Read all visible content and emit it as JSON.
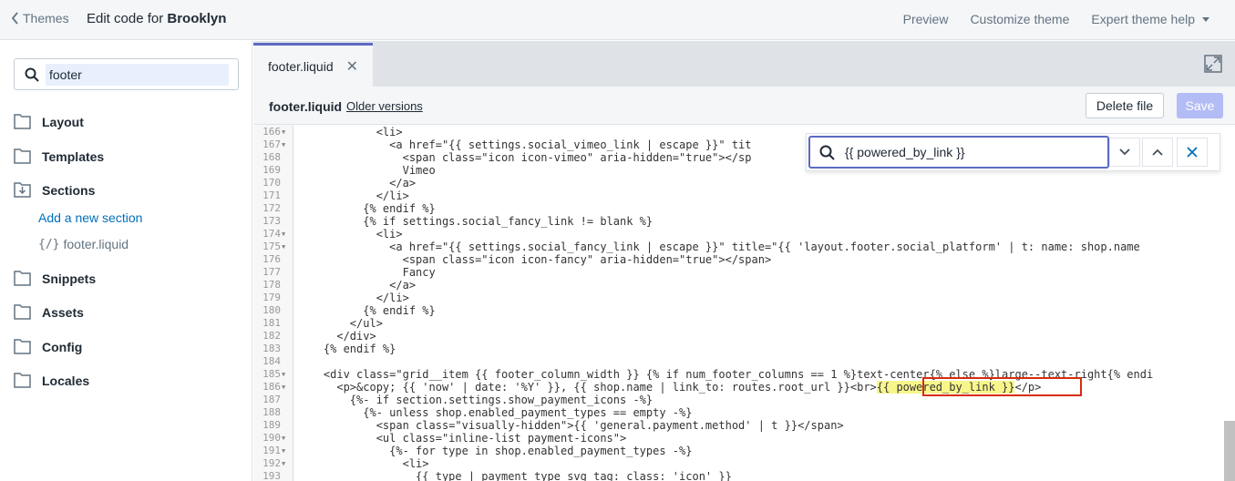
{
  "topbar": {
    "back_label": "Themes",
    "title_prefix": "Edit code for ",
    "title_theme": "Brooklyn",
    "preview": "Preview",
    "customize": "Customize theme",
    "help": "Expert theme help"
  },
  "sidebar": {
    "search_value": "footer",
    "folders": {
      "layout": "Layout",
      "templates": "Templates",
      "sections": "Sections",
      "snippets": "Snippets",
      "assets": "Assets",
      "config": "Config",
      "locales": "Locales"
    },
    "add_section": "Add a new section",
    "file_icon": "{/}",
    "file_name": "footer.liquid"
  },
  "editor": {
    "tab_label": "footer.liquid",
    "file_name": "footer.liquid",
    "older_versions": "Older versions",
    "delete_label": "Delete file",
    "save_label": "Save",
    "find_value": "{{ powered_by_link }}"
  },
  "code_lines": [
    {
      "n": "166",
      "fold": true
    },
    {
      "n": "167",
      "fold": true
    },
    {
      "n": "168",
      "fold": false
    },
    {
      "n": "169",
      "fold": false
    },
    {
      "n": "170",
      "fold": false
    },
    {
      "n": "171",
      "fold": false
    },
    {
      "n": "172",
      "fold": false
    },
    {
      "n": "173",
      "fold": false
    },
    {
      "n": "174",
      "fold": true
    },
    {
      "n": "175",
      "fold": true
    },
    {
      "n": "176",
      "fold": false
    },
    {
      "n": "177",
      "fold": false
    },
    {
      "n": "178",
      "fold": false
    },
    {
      "n": "179",
      "fold": false
    },
    {
      "n": "180",
      "fold": false
    },
    {
      "n": "181",
      "fold": false
    },
    {
      "n": "182",
      "fold": false
    },
    {
      "n": "183",
      "fold": false
    },
    {
      "n": "184",
      "fold": false
    },
    {
      "n": "185",
      "fold": true
    },
    {
      "n": "186",
      "fold": true
    },
    {
      "n": "187",
      "fold": false
    },
    {
      "n": "188",
      "fold": false
    },
    {
      "n": "189",
      "fold": false
    },
    {
      "n": "190",
      "fold": true
    },
    {
      "n": "191",
      "fold": true
    },
    {
      "n": "192",
      "fold": true
    },
    {
      "n": "193",
      "fold": false
    }
  ],
  "code_text": [
    "            <li>",
    "              <a href=\"{{ settings.social_vimeo_link | escape }}\" tit",
    "                <span class=\"icon icon-vimeo\" aria-hidden=\"true\"></sp",
    "                Vimeo",
    "              </a>",
    "            </li>",
    "          {% endif %}",
    "          {% if settings.social_fancy_link != blank %}",
    "            <li>",
    "              <a href=\"{{ settings.social_fancy_link | escape }}\" title=\"{{ 'layout.footer.social_platform' | t: name: shop.name",
    "                <span class=\"icon icon-fancy\" aria-hidden=\"true\"></span>",
    "                Fancy",
    "              </a>",
    "            </li>",
    "          {% endif %}",
    "        </ul>",
    "      </div>",
    "    {% endif %}",
    "",
    "    <div class=\"grid__item {{ footer_column_width }} {% if num_footer_columns == 1 %}text-center{% else %}large--text-right{% endi",
    "      <p>&copy; {{ 'now' | date: '%Y' }}, {{ shop.name | link_to: routes.root_url }}<br>",
    "        {%- if section.settings.show_payment_icons -%}",
    "          {%- unless shop.enabled_payment_types == empty -%}",
    "            <span class=\"visually-hidden\">{{ 'general.payment.method' | t }}</span>",
    "            <ul class=\"inline-list payment-icons\">",
    "              {%- for type in shop.enabled_payment_types -%}",
    "                <li>",
    "                  {{ type | payment_type_svg_tag: class: 'icon' }}"
  ],
  "highlight_text": "{{ powered_by_link }}",
  "after_highlight": "</p>"
}
